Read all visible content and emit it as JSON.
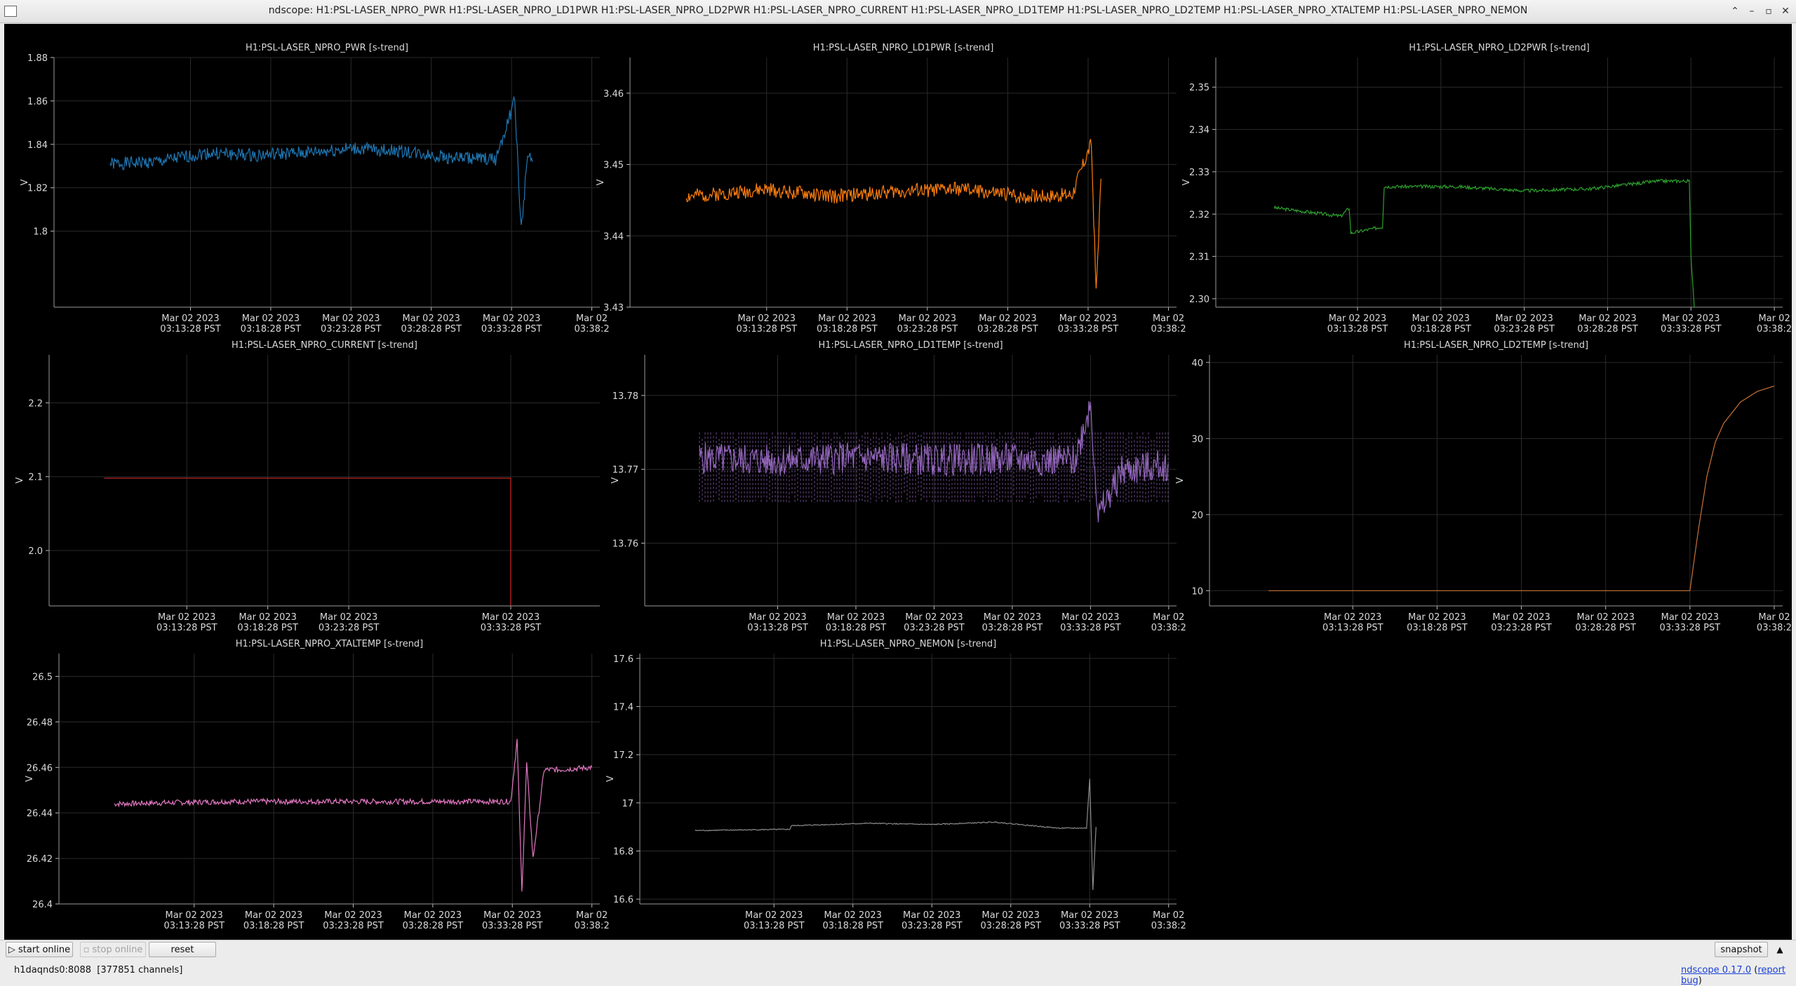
{
  "window": {
    "title": "ndscope: H1:PSL-LASER_NPRO_PWR H1:PSL-LASER_NPRO_LD1PWR H1:PSL-LASER_NPRO_LD2PWR H1:PSL-LASER_NPRO_CURRENT H1:PSL-LASER_NPRO_LD1TEMP H1:PSL-LASER_NPRO_LD2TEMP H1:PSL-LASER_NPRO_XTALTEMP H1:PSL-LASER_NPRO_NEMON",
    "buttons": {
      "minimize": "⌃",
      "restore": "–",
      "maximize": "▫",
      "close": "✕"
    }
  },
  "toolbar": {
    "start_online": "start online",
    "stop_online": "stop online",
    "reset": "reset",
    "snapshot": "snapshot",
    "collapse_glyph": "▲"
  },
  "status": {
    "server": "h1daqnds0:8088",
    "channels": "[377851 channels]",
    "version": "ndscope 0.17.0",
    "report_bug": "report bug"
  },
  "chart_data": [
    {
      "type": "line",
      "title": "H1:PSL-LASER_NPRO_PWR [s-trend]",
      "ylabel": "V",
      "color": "#1f77b4",
      "ylim": [
        1.765,
        1.88
      ],
      "yticks": [
        1.8,
        1.82,
        1.84,
        1.86,
        1.88
      ],
      "yticklabels": [
        "1.8",
        "1.82",
        "1.84",
        "1.86",
        "1.88"
      ],
      "xtick_dates": [
        "Mar 02 2023",
        "Mar 02 2023",
        "Mar 02 2023",
        "Mar 02 2023",
        "Mar 02 2023",
        "Mar 02"
      ],
      "xtick_times": [
        "03:13:28 PST",
        "03:18:28 PST",
        "03:23:28 PST",
        "03:28:28 PST",
        "03:33:28 PST",
        "03:38:2"
      ],
      "x": [
        -25,
        -22,
        -19,
        -16,
        -13,
        -10,
        -7,
        -4,
        -1,
        0.2,
        0.6,
        1.0,
        1.3
      ],
      "y": [
        1.831,
        1.832,
        1.836,
        1.835,
        1.836,
        1.838,
        1.837,
        1.834,
        1.833,
        1.86,
        1.8,
        1.835,
        1.832
      ],
      "band": 0.003
    },
    {
      "type": "line",
      "title": "H1:PSL-LASER_NPRO_LD1PWR [s-trend]",
      "ylabel": "V",
      "color": "#ff7f0e",
      "ylim": [
        3.43,
        3.465
      ],
      "yticks": [
        3.43,
        3.44,
        3.45,
        3.46
      ],
      "yticklabels": [
        "3.43",
        "3.44",
        "3.45",
        "3.46"
      ],
      "xtick_dates": [
        "Mar 02 2023",
        "Mar 02 2023",
        "Mar 02 2023",
        "Mar 02 2023",
        "Mar 02 2023",
        "Mar 02"
      ],
      "xtick_times": [
        "03:13:28 PST",
        "03:18:28 PST",
        "03:23:28 PST",
        "03:28:28 PST",
        "03:33:28 PST",
        "03:38:2"
      ],
      "x": [
        -25,
        -20,
        -16,
        -12,
        -8,
        -4,
        -1,
        0.2,
        0.5,
        0.8
      ],
      "y": [
        3.4455,
        3.4465,
        3.4455,
        3.4462,
        3.4466,
        3.4455,
        3.4458,
        3.453,
        3.432,
        3.448
      ],
      "band": 0.001
    },
    {
      "type": "line",
      "title": "H1:PSL-LASER_NPRO_LD2PWR [s-trend]",
      "ylabel": "V",
      "color": "#2ca02c",
      "ylim": [
        2.298,
        2.357
      ],
      "yticks": [
        2.3,
        2.31,
        2.32,
        2.33,
        2.34,
        2.35
      ],
      "yticklabels": [
        "2.30",
        "2.31",
        "2.32",
        "2.33",
        "2.34",
        "2.35"
      ],
      "xtick_dates": [
        "Mar 02 2023",
        "Mar 02 2023",
        "Mar 02 2023",
        "Mar 02 2023",
        "Mar 02 2023",
        "Mar 02"
      ],
      "xtick_times": [
        "03:13:28 PST",
        "03:18:28 PST",
        "03:23:28 PST",
        "03:28:28 PST",
        "03:33:28 PST",
        "03:38:2"
      ],
      "x": [
        -25,
        -23,
        -21,
        -20.5,
        -20.4,
        -18.5,
        -18.4,
        -14,
        -10,
        -6,
        -2,
        -0.1,
        0.0,
        0.2
      ],
      "y": [
        2.3215,
        2.3205,
        2.3195,
        2.3215,
        2.3155,
        2.317,
        2.3265,
        2.3265,
        2.3255,
        2.326,
        2.3278,
        2.3278,
        2.31,
        2.298
      ],
      "band": 0.0004
    },
    {
      "type": "line",
      "title": "H1:PSL-LASER_NPRO_CURRENT [s-trend]",
      "ylabel": "V",
      "color": "#d62728",
      "ylim": [
        1.925,
        2.265
      ],
      "yticks": [
        2.0,
        2.1,
        2.2
      ],
      "yticklabels": [
        "2.0",
        "2.1",
        "2.2"
      ],
      "xtick_dates": [
        "Mar 02 2023",
        "Mar 02 2023",
        "Mar 02 2023",
        "Mar 02 2023"
      ],
      "xtick_times": [
        "03:13:28 PST",
        "03:18:28 PST",
        "03:23:28 PST",
        "03:33:28 PST"
      ],
      "xtick_positions": [
        -20,
        -15,
        -10,
        0
      ],
      "x": [
        -25.1,
        0.0,
        0.0
      ],
      "y": [
        2.098,
        2.098,
        1.925
      ],
      "band": 0
    },
    {
      "type": "line",
      "title": "H1:PSL-LASER_NPRO_LD1TEMP [s-trend]",
      "ylabel": "V",
      "color": "#9467bd",
      "ylim": [
        13.7515,
        13.7855
      ],
      "yticks": [
        13.76,
        13.77,
        13.78
      ],
      "yticklabels": [
        "13.76",
        "13.77",
        "13.78"
      ],
      "xtick_dates": [
        "Mar 02 2023",
        "Mar 02 2023",
        "Mar 02 2023",
        "Mar 02 2023",
        "Mar 02 2023",
        "Mar 02"
      ],
      "xtick_times": [
        "03:13:28 PST",
        "03:18:28 PST",
        "03:23:28 PST",
        "03:28:28 PST",
        "03:33:28 PST",
        "03:38:2"
      ],
      "x": [
        -25,
        -20,
        -15,
        -10,
        -5,
        -1,
        0,
        0.5,
        2,
        5
      ],
      "y": [
        13.7715,
        13.7712,
        13.7716,
        13.7713,
        13.7714,
        13.7712,
        13.779,
        13.7635,
        13.7698,
        13.7706
      ],
      "band": 0.0022,
      "dashed_band": [
        13.7655,
        13.775
      ]
    },
    {
      "type": "line",
      "title": "H1:PSL-LASER_NPRO_LD2TEMP [s-trend]",
      "ylabel": "V",
      "color": "#c87137",
      "ylim": [
        8,
        41
      ],
      "yticks": [
        10,
        20,
        30,
        40
      ],
      "yticklabels": [
        "10",
        "20",
        "30",
        "40"
      ],
      "xtick_dates": [
        "Mar 02 2023",
        "Mar 02 2023",
        "Mar 02 2023",
        "Mar 02 2023",
        "Mar 02 2023",
        "Mar 02"
      ],
      "xtick_times": [
        "03:13:28 PST",
        "03:18:28 PST",
        "03:23:28 PST",
        "03:28:28 PST",
        "03:33:28 PST",
        "03:38:2"
      ],
      "x": [
        -25,
        0,
        0.5,
        1,
        1.5,
        2,
        3,
        4,
        5
      ],
      "y": [
        10,
        10,
        18,
        25,
        29.5,
        32,
        34.8,
        36.2,
        36.9
      ],
      "band": 0
    },
    {
      "type": "line",
      "title": "H1:PSL-LASER_NPRO_XTALTEMP [s-trend]",
      "ylabel": "V",
      "color": "#e377c2",
      "ylim": [
        26.4,
        26.51
      ],
      "yticks": [
        26.4,
        26.42,
        26.44,
        26.46,
        26.48,
        26.5
      ],
      "yticklabels": [
        "26.4",
        "26.42",
        "26.44",
        "26.46",
        "26.48",
        "26.5"
      ],
      "xtick_dates": [
        "Mar 02 2023",
        "Mar 02 2023",
        "Mar 02 2023",
        "Mar 02 2023",
        "Mar 02 2023",
        "Mar 02"
      ],
      "xtick_times": [
        "03:13:28 PST",
        "03:18:28 PST",
        "03:23:28 PST",
        "03:28:28 PST",
        "03:33:28 PST",
        "03:38:2"
      ],
      "x": [
        -25,
        -18,
        -12,
        -6,
        -1,
        -0.1,
        0.3,
        0.6,
        0.9,
        1.3,
        2,
        3,
        5
      ],
      "y": [
        26.444,
        26.445,
        26.445,
        26.445,
        26.445,
        26.445,
        26.472,
        26.405,
        26.462,
        26.42,
        26.459,
        26.459,
        26.46
      ],
      "band": 0.0012
    },
    {
      "type": "line",
      "title": "H1:PSL-LASER_NPRO_NEMON [s-trend]",
      "ylabel": "V",
      "color": "#8c8c8c",
      "ylim": [
        16.58,
        17.62
      ],
      "yticks": [
        16.6,
        16.8,
        17.0,
        17.2,
        17.4,
        17.6
      ],
      "yticklabels": [
        "16.6",
        "16.8",
        "17",
        "17.2",
        "17.4",
        "17.6"
      ],
      "xtick_dates": [
        "Mar 02 2023",
        "Mar 02 2023",
        "Mar 02 2023",
        "Mar 02 2023",
        "Mar 02 2023",
        "Mar 02"
      ],
      "xtick_times": [
        "03:13:28 PST",
        "03:18:28 PST",
        "03:23:28 PST",
        "03:28:28 PST",
        "03:33:28 PST",
        "03:38:2"
      ],
      "x": [
        -25,
        -19,
        -18.9,
        -14,
        -10,
        -6,
        -2,
        -0.2,
        0,
        0.2,
        0.4
      ],
      "y": [
        16.885,
        16.89,
        16.905,
        16.915,
        16.91,
        16.92,
        16.895,
        16.895,
        17.1,
        16.64,
        16.9
      ],
      "band": 0.002
    }
  ]
}
